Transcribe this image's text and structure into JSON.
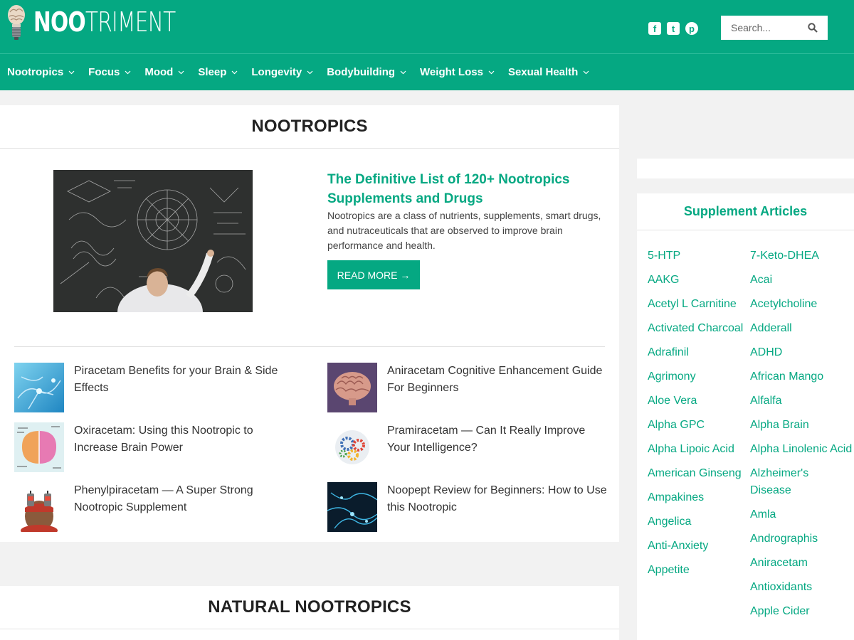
{
  "site": {
    "logo_bold": "NOO",
    "logo_light": "TRIMENT"
  },
  "social": [
    {
      "icon": "facebook-icon",
      "glyph": "f"
    },
    {
      "icon": "twitter-icon",
      "glyph": "t"
    },
    {
      "icon": "pinterest-icon",
      "glyph": "p"
    }
  ],
  "search": {
    "placeholder": "Search..."
  },
  "nav": {
    "items": [
      "Nootropics",
      "Focus",
      "Mood",
      "Sleep",
      "Longevity",
      "Bodybuilding",
      "Weight Loss",
      "Sexual Health"
    ]
  },
  "section1": {
    "title": "NOOTROPICS",
    "featured": {
      "title": "The Definitive List of 120+ Nootropics Supplements and Drugs",
      "description": "Nootropics are a class of nutrients, supplements, smart drugs, and nutraceuticals that are observed to improve brain performance and health.",
      "button": "READ MORE →"
    },
    "posts": [
      {
        "title": "Piracetam Benefits for your Brain & Side Effects"
      },
      {
        "title": "Aniracetam Cognitive Enhancement Guide For Beginners"
      },
      {
        "title": "Oxiracetam: Using this Nootropic to Increase Brain Power"
      },
      {
        "title": "Pramiracetam — Can It Really Improve Your Intelligence?"
      },
      {
        "title": "Phenylpiracetam — A Super Strong Nootropic Supplement"
      },
      {
        "title": "Noopept Review for Beginners: How to Use this Nootropic"
      }
    ]
  },
  "section2": {
    "title": "NATURAL NOOTROPICS"
  },
  "sidebar": {
    "title": "Supplement Articles",
    "col1": [
      "5-HTP",
      "AAKG",
      "Acetyl L Carnitine",
      "Activated Charcoal",
      "Adrafinil",
      "Agrimony",
      "Aloe Vera",
      "Alpha GPC",
      "Alpha Lipoic Acid",
      "American Ginseng",
      "Ampakines",
      "Angelica",
      "Anti-Anxiety",
      "Appetite"
    ],
    "col2": [
      "7-Keto-DHEA",
      "Acai",
      "Acetylcholine",
      "Adderall",
      "ADHD",
      "African Mango",
      "Alfalfa",
      "Alpha Brain",
      "Alpha Linolenic Acid",
      "Alzheimer's Disease",
      "Amla",
      "Andrographis",
      "Aniracetam",
      "Antioxidants",
      "Apple Cider"
    ]
  },
  "colors": {
    "brand": "#05a882",
    "background": "#f2f2f2"
  }
}
